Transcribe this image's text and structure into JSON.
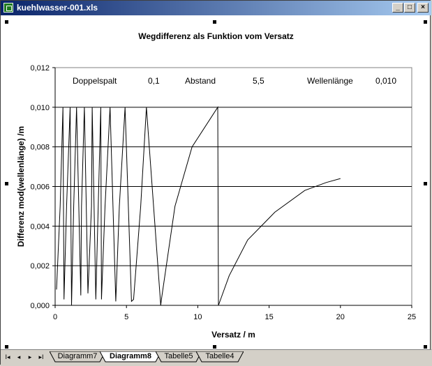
{
  "window": {
    "title": "kuehlwasser-001.xls",
    "buttons": {
      "minimize": "_",
      "maximize": "□",
      "close": "×"
    }
  },
  "chart_data": {
    "type": "line",
    "title": "Wegdifferenz als Funktion vom Versatz",
    "xlabel": "Versatz / m",
    "ylabel": "Differenz mod(wellenlänge) /m",
    "xlim": [
      0,
      25
    ],
    "ylim": [
      0,
      0.012
    ],
    "x_ticks": [
      "0",
      "5",
      "10",
      "15",
      "20",
      "25"
    ],
    "y_ticks": [
      "0,000",
      "0,002",
      "0,004",
      "0,006",
      "0,008",
      "0,010",
      "0,012"
    ],
    "grid": "horizontal",
    "legend": "none",
    "parameters": [
      {
        "label": "Doppelspalt",
        "value": "0,1"
      },
      {
        "label": "Abstand",
        "value": "5,5"
      },
      {
        "label": "Wellenlänge",
        "value": "0,010"
      }
    ],
    "series": [
      {
        "x": [
          0.1,
          0.35,
          0.55,
          0.62,
          0.8,
          1.05,
          1.15,
          1.3,
          1.5,
          1.8,
          1.85,
          2.05,
          2.3,
          2.55,
          2.6,
          2.85,
          3.2,
          3.25,
          3.5,
          3.85,
          4.25,
          4.5,
          4.9,
          5.35,
          5.5,
          6.0,
          6.4,
          7.4,
          7.45,
          8.4,
          9.6,
          11.4,
          11.45,
          12.2,
          13.5,
          15.4,
          17.5,
          19.0,
          20.0
        ],
        "y": [
          0.0008,
          0.005,
          0.01,
          0.0003,
          0.005,
          0.01,
          0.0,
          0.005,
          0.01,
          0.0005,
          0.005,
          0.01,
          0.0006,
          0.005,
          0.01,
          0.0003,
          0.01,
          0.0003,
          0.005,
          0.01,
          0.0002,
          0.005,
          0.01,
          0.0002,
          0.0003,
          0.005,
          0.01,
          0.0,
          0.0003,
          0.005,
          0.008,
          0.01,
          0.0,
          0.0015,
          0.0033,
          0.0047,
          0.0058,
          0.0062,
          0.0064
        ]
      }
    ]
  },
  "sheet_tabs": [
    "Diagramm7",
    "Diagramm8",
    "Tabelle5",
    "Tabelle4"
  ],
  "active_tab": "Diagramm8",
  "nav_buttons": [
    "I◂",
    "◂",
    "▸",
    "▸I"
  ]
}
